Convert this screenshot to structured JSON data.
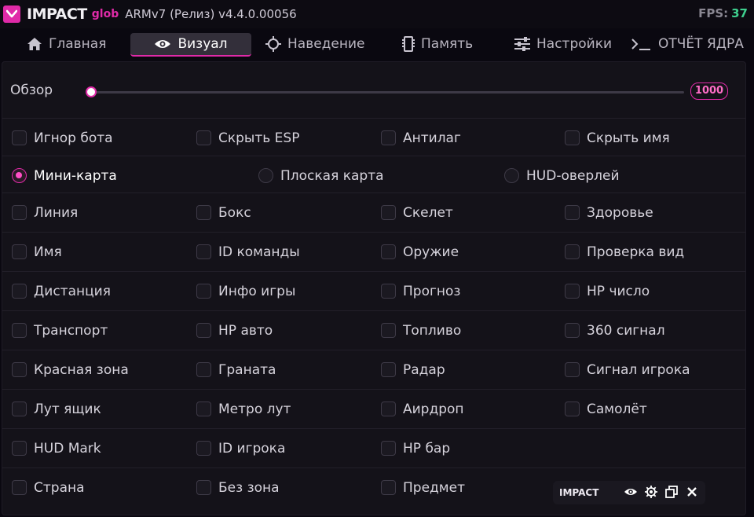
{
  "title": {
    "app_name": "IMPACT",
    "tag": "glob",
    "version": "ARMv7 (Релиз)  v4.4.0.00056",
    "fps_label": "FPS:",
    "fps_value": "37"
  },
  "tabs": [
    {
      "label": "Главная",
      "icon": "home-icon"
    },
    {
      "label": "Визуал",
      "icon": "eye-icon",
      "active": true
    },
    {
      "label": "Наведение",
      "icon": "crosshair-icon"
    },
    {
      "label": "Память",
      "icon": "memory-icon"
    },
    {
      "label": "Настройки",
      "icon": "sliders-icon"
    },
    {
      "label": "ОТЧЁТ ЯДРА",
      "icon": "terminal-icon"
    }
  ],
  "slider": {
    "label": "Обзор",
    "value": "1000"
  },
  "options": {
    "row1": [
      "Игнор бота",
      "Скрыть ESP",
      "Антилаг",
      "Скрыть имя"
    ],
    "radios": [
      "Мини-карта",
      "Плоская карта",
      "HUD-оверлей"
    ],
    "selected_radio": "Мини-карта",
    "row3": [
      "Линия",
      "Бокс",
      "Скелет",
      "Здоровье"
    ],
    "row4": [
      "Имя",
      "ID команды",
      "Оружие",
      "Проверка вид"
    ],
    "row5": [
      "Дистанция",
      "Инфо игры",
      "Прогноз",
      "HP число"
    ],
    "row6": [
      "Транспорт",
      "HP авто",
      "Топливо",
      "360 сигнал"
    ],
    "row7": [
      "Красная зона",
      "Граната",
      "Радар",
      "Сигнал игрока"
    ],
    "row8": [
      "Лут ящик",
      "Метро лут",
      "Аирдроп",
      "Самолёт"
    ],
    "row9": [
      "HUD Mark",
      "ID игрока",
      "HP бар"
    ],
    "row10": [
      "Страна",
      "Без зона",
      "Предмет"
    ]
  },
  "mini_bar": {
    "title": "IMPACT"
  },
  "colors": {
    "accent": "#e02aa8",
    "fps": "#3fd08f",
    "bg": "#0a0810",
    "panel": "#141219"
  }
}
